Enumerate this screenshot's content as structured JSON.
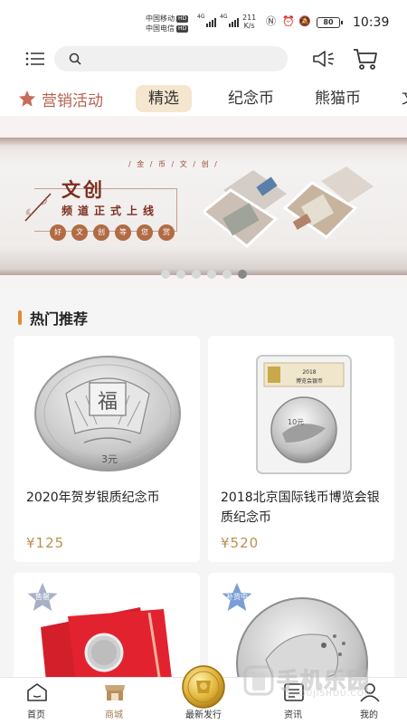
{
  "status_bar": {
    "carrier_1": "中国移动",
    "carrier_1_tag": "HD",
    "carrier_2": "中国电信",
    "carrier_2_tag": "HD",
    "network_1": "4G",
    "network_2": "4G",
    "speed_value": "211",
    "speed_unit": "K/s",
    "battery": "80",
    "time": "10:39"
  },
  "header": {
    "search_value": "",
    "search_placeholder": ""
  },
  "tabs": {
    "promo_label": "营销活动",
    "items": [
      {
        "label": "精选",
        "active": true
      },
      {
        "label": "纪念币",
        "active": false
      },
      {
        "label": "熊猫币",
        "active": false
      },
      {
        "label": "文",
        "active": false
      }
    ]
  },
  "banner": {
    "subtitle": "/ 金 / 币 / 文 / 创 /",
    "title": "文创",
    "caption": "频道正式上线",
    "seal_chars": [
      "好",
      "文",
      "创",
      "等",
      "您",
      "赏"
    ],
    "slide_count": 6,
    "active_slide": 5
  },
  "section": {
    "title": "热门推荐"
  },
  "products": [
    {
      "name": "2020年贺岁银质纪念币",
      "price": "¥125",
      "badge": "",
      "coin_text": "福",
      "coin_value": "3元"
    },
    {
      "name": "2018北京国际钱币博览会银质纪念币",
      "price": "¥520",
      "badge": "",
      "coin_text": "博览会银币",
      "coin_value": "10元"
    },
    {
      "name": "",
      "price": "",
      "badge": "售罄"
    },
    {
      "name": "",
      "price": "",
      "badge": "补货中"
    }
  ],
  "bottom_nav": {
    "items": [
      {
        "label": "首页",
        "active": false
      },
      {
        "label": "商城",
        "active": true
      },
      {
        "label": "最新发行",
        "active": false
      },
      {
        "label": "资讯",
        "active": false
      },
      {
        "label": "我的",
        "active": false
      }
    ]
  },
  "watermark": {
    "text": "手机乐园",
    "sub": "SHOUJISHOU.COM"
  },
  "colors": {
    "accent_gold": "#b99050",
    "tab_active_bg": "#f5e6cf",
    "promo_red": "#b4614e",
    "section_bar": "#e28a2f"
  }
}
